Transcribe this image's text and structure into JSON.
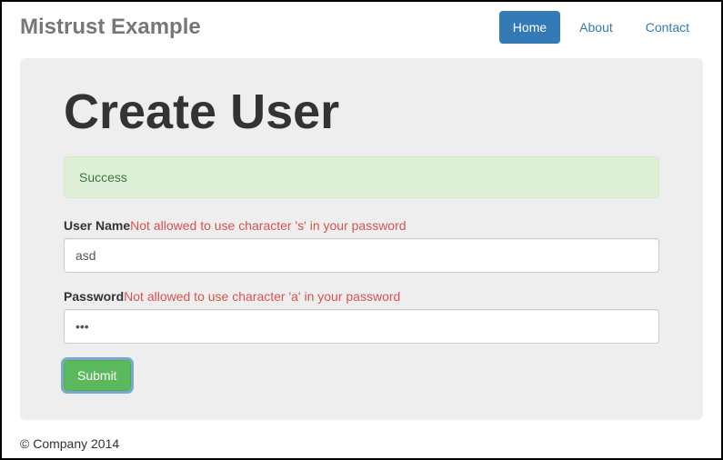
{
  "brand": "Mistrust Example",
  "nav": {
    "home": "Home",
    "about": "About",
    "contact": "Contact"
  },
  "page": {
    "title": "Create User",
    "alert": "Success"
  },
  "form": {
    "username": {
      "label": "User Name",
      "error": "Not allowed to use character 's' in your password",
      "value": "asd"
    },
    "password": {
      "label": "Password",
      "error": "Not allowed to use character 'a' in your password",
      "value": "•••"
    },
    "submit": "Submit"
  },
  "footer": "© Company 2014"
}
